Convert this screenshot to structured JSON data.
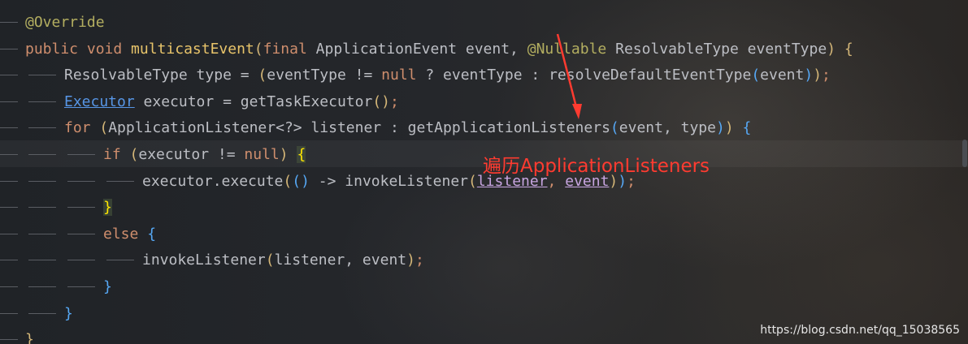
{
  "editor": {
    "lines": [
      {
        "indent": 0,
        "tokens": [
          {
            "t": "@Override",
            "c": "ann"
          }
        ]
      },
      {
        "indent": 0,
        "tokens": [
          {
            "t": "public ",
            "c": "kw"
          },
          {
            "t": "void ",
            "c": "kw"
          },
          {
            "t": "multicastEvent",
            "c": "fn"
          },
          {
            "t": "(",
            "c": "br1"
          },
          {
            "t": "final ",
            "c": "kw"
          },
          {
            "t": "ApplicationEvent event, ",
            "c": "plain"
          },
          {
            "t": "@Nullable ",
            "c": "ann"
          },
          {
            "t": "ResolvableType eventType",
            "c": "plain"
          },
          {
            "t": ") ",
            "c": "br1"
          },
          {
            "t": "{",
            "c": "br1"
          }
        ]
      },
      {
        "indent": 1,
        "tokens": [
          {
            "t": "ResolvableType type = ",
            "c": "plain"
          },
          {
            "t": "(",
            "c": "br1"
          },
          {
            "t": "eventType != ",
            "c": "plain"
          },
          {
            "t": "null",
            "c": "kw"
          },
          {
            "t": " ? eventType : resolveDefaultEventType",
            "c": "plain"
          },
          {
            "t": "(",
            "c": "br2"
          },
          {
            "t": "event",
            "c": "plain"
          },
          {
            "t": ")",
            "c": "br2"
          },
          {
            "t": ")",
            "c": "br1"
          },
          {
            "t": ";",
            "c": "kw"
          }
        ]
      },
      {
        "indent": 1,
        "tokens": [
          {
            "t": "Executor",
            "c": "link"
          },
          {
            "t": " executor = getTaskExecutor",
            "c": "plain"
          },
          {
            "t": "()",
            "c": "br1"
          },
          {
            "t": ";",
            "c": "kw"
          }
        ]
      },
      {
        "indent": 1,
        "tokens": [
          {
            "t": "for ",
            "c": "kw"
          },
          {
            "t": "(",
            "c": "br1"
          },
          {
            "t": "ApplicationListener<?> listener : getApplicationListeners",
            "c": "plain"
          },
          {
            "t": "(",
            "c": "br2"
          },
          {
            "t": "event, type",
            "c": "plain"
          },
          {
            "t": ")",
            "c": "br2"
          },
          {
            "t": ")",
            "c": "br1"
          },
          {
            "t": " ",
            "c": "plain"
          },
          {
            "t": "{",
            "c": "br2"
          }
        ]
      },
      {
        "indent": 2,
        "tokens": [
          {
            "t": "if ",
            "c": "kw"
          },
          {
            "t": "(",
            "c": "br1"
          },
          {
            "t": "executor != ",
            "c": "plain"
          },
          {
            "t": "null",
            "c": "kw"
          },
          {
            "t": ")",
            "c": "br1"
          },
          {
            "t": " ",
            "c": "plain"
          },
          {
            "t": "{",
            "c": "hl-brace"
          }
        ]
      },
      {
        "indent": 3,
        "tokens": [
          {
            "t": "executor.execute",
            "c": "plain"
          },
          {
            "t": "(",
            "c": "br1"
          },
          {
            "t": "()",
            "c": "br2"
          },
          {
            "t": " -> invokeListener",
            "c": "plain"
          },
          {
            "t": "(",
            "c": "br1"
          },
          {
            "t": "listener",
            "c": "ul"
          },
          {
            "t": ", ",
            "c": "kw"
          },
          {
            "t": "event",
            "c": "ul"
          },
          {
            "t": ")",
            "c": "br1"
          },
          {
            "t": ")",
            "c": "br2"
          },
          {
            "t": ";",
            "c": "kw"
          }
        ]
      },
      {
        "indent": 2,
        "tokens": [
          {
            "t": "}",
            "c": "hl-brace"
          }
        ]
      },
      {
        "indent": 2,
        "tokens": [
          {
            "t": "else ",
            "c": "kw"
          },
          {
            "t": "{",
            "c": "br2"
          }
        ]
      },
      {
        "indent": 3,
        "tokens": [
          {
            "t": "invokeListener",
            "c": "plain"
          },
          {
            "t": "(",
            "c": "br1"
          },
          {
            "t": "listener, event",
            "c": "plain"
          },
          {
            "t": ")",
            "c": "br1"
          },
          {
            "t": ";",
            "c": "kw"
          }
        ]
      },
      {
        "indent": 2,
        "tokens": [
          {
            "t": "}",
            "c": "br2"
          }
        ]
      },
      {
        "indent": 1,
        "tokens": [
          {
            "t": "}",
            "c": "br2"
          }
        ]
      },
      {
        "indent": 0,
        "tokens": [
          {
            "t": "}",
            "c": "br1"
          }
        ]
      }
    ]
  },
  "annotation": {
    "label": "遍历ApplicationListeners",
    "color": "#ff3b30"
  },
  "watermark": "https://blog.csdn.net/qq_15038565",
  "colors": {
    "keyword": "#cf8e6d",
    "annotation": "#b3ae60",
    "method": "#e8c46a",
    "identifier": "#bcbec4",
    "type_link": "#5796e6",
    "highlight_brace": "#ffe600"
  }
}
